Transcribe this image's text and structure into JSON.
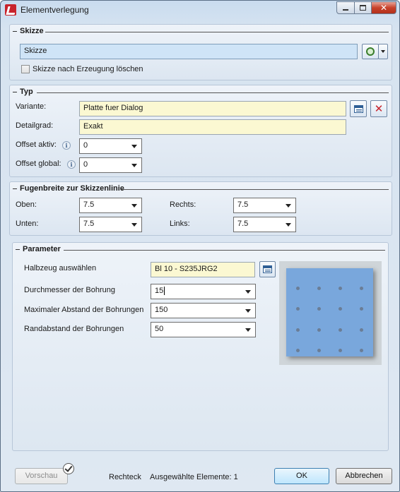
{
  "window": {
    "title": "Elementverlegung",
    "close_label": "✕"
  },
  "skizze": {
    "header": "Skizze",
    "sketch_value": "Skizze",
    "delete_checkbox_label": "Skizze nach Erzeugung löschen",
    "delete_checked": false
  },
  "typ": {
    "header": "Typ",
    "variante_label": "Variante:",
    "variante_value": "Platte fuer Dialog",
    "detailgrad_label": "Detailgrad:",
    "detailgrad_value": "Exakt",
    "offset_aktiv_label": "Offset aktiv:",
    "offset_aktiv_value": "0",
    "offset_global_label": "Offset global:",
    "offset_global_value": "0",
    "info_glyph": "i"
  },
  "fugen": {
    "header": "Fugenbreite zur Skizzenlinie",
    "oben_label": "Oben:",
    "oben_value": "7.5",
    "unten_label": "Unten:",
    "unten_value": "7.5",
    "rechts_label": "Rechts:",
    "rechts_value": "7.5",
    "links_label": "Links:",
    "links_value": "7.5"
  },
  "parameter": {
    "header": "Parameter",
    "halbzeug_label": "Halbzeug auswählen",
    "halbzeug_value": "Bl 10 - S235JRG2",
    "durchmesser_label": "Durchmesser der Bohrung",
    "durchmesser_value": "15",
    "max_abstand_label": "Maximaler Abstand der Bohrungen",
    "max_abstand_value": "150",
    "randabstand_label": "Randabstand der Bohrungen",
    "randabstand_value": "50"
  },
  "footer": {
    "vorschau_label": "Vorschau",
    "shape_label": "Rechteck",
    "selected_label": "Ausgewählte Elemente: 1",
    "ok_label": "OK",
    "cancel_label": "Abbrechen"
  }
}
